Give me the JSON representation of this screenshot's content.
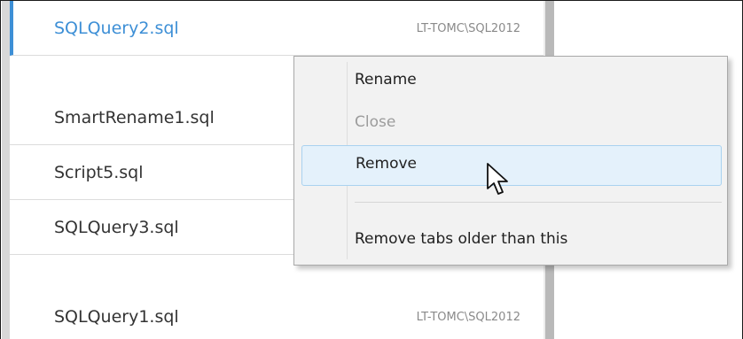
{
  "tabs": [
    {
      "name": "SQLQuery2.sql",
      "server": "LT-TOMC\\SQL2012",
      "active": true
    },
    {
      "name": "SmartRename1.sql",
      "server": "",
      "active": false
    },
    {
      "name": "Script5.sql",
      "server": "",
      "active": false
    },
    {
      "name": "SQLQuery3.sql",
      "server": "",
      "active": false
    },
    {
      "name": "SQLQuery1.sql",
      "server": "LT-TOMC\\SQL2012",
      "active": false
    }
  ],
  "context_menu": {
    "items": [
      {
        "label": "Rename",
        "enabled": true,
        "highlighted": false
      },
      {
        "label": "Close",
        "enabled": false,
        "highlighted": false
      },
      {
        "label": "Remove",
        "enabled": true,
        "highlighted": true
      },
      {
        "label": "Remove tabs older than this",
        "enabled": true,
        "highlighted": false
      }
    ]
  },
  "colors": {
    "active_accent": "#3d8fd6",
    "menu_background": "#f2f2f2",
    "menu_highlight": "#e4f1fb",
    "disabled_text": "#9c9c9c"
  },
  "icons": {
    "pointer": "mouse-pointer-icon"
  }
}
